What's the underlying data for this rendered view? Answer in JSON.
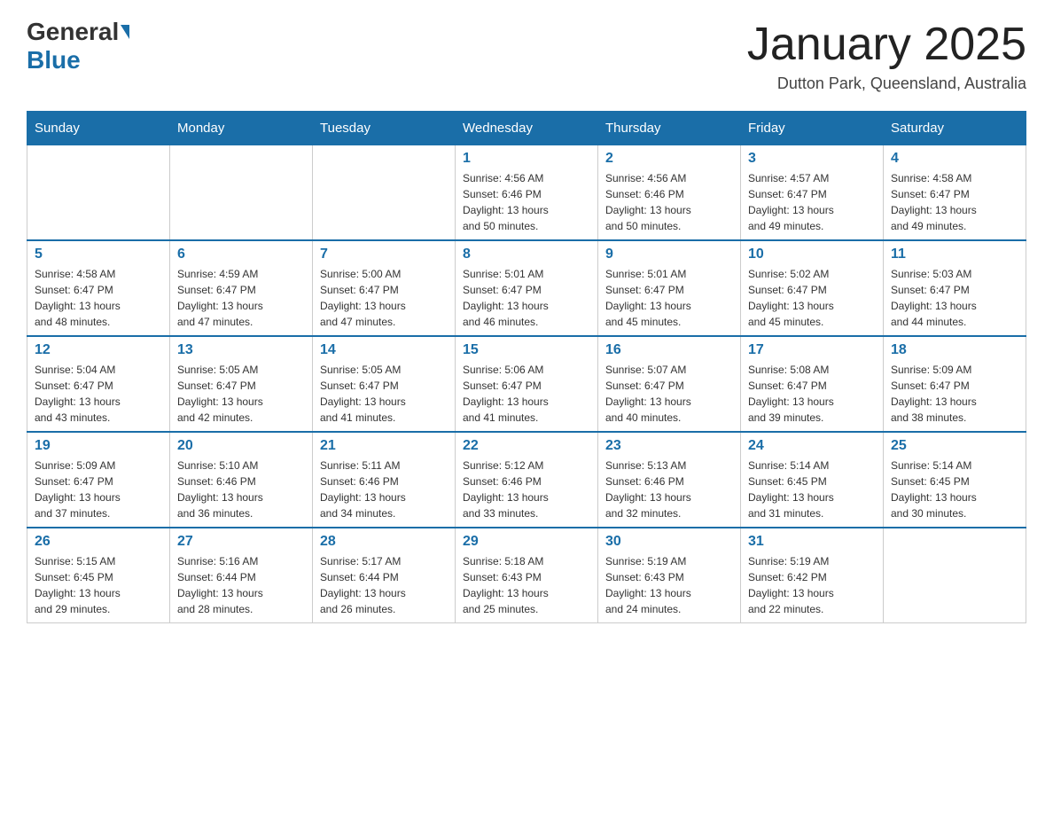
{
  "header": {
    "logo_general": "General",
    "logo_blue": "Blue",
    "month_title": "January 2025",
    "location": "Dutton Park, Queensland, Australia"
  },
  "days_of_week": [
    "Sunday",
    "Monday",
    "Tuesday",
    "Wednesday",
    "Thursday",
    "Friday",
    "Saturday"
  ],
  "weeks": [
    [
      {
        "day": "",
        "info": ""
      },
      {
        "day": "",
        "info": ""
      },
      {
        "day": "",
        "info": ""
      },
      {
        "day": "1",
        "info": "Sunrise: 4:56 AM\nSunset: 6:46 PM\nDaylight: 13 hours\nand 50 minutes."
      },
      {
        "day": "2",
        "info": "Sunrise: 4:56 AM\nSunset: 6:46 PM\nDaylight: 13 hours\nand 50 minutes."
      },
      {
        "day": "3",
        "info": "Sunrise: 4:57 AM\nSunset: 6:47 PM\nDaylight: 13 hours\nand 49 minutes."
      },
      {
        "day": "4",
        "info": "Sunrise: 4:58 AM\nSunset: 6:47 PM\nDaylight: 13 hours\nand 49 minutes."
      }
    ],
    [
      {
        "day": "5",
        "info": "Sunrise: 4:58 AM\nSunset: 6:47 PM\nDaylight: 13 hours\nand 48 minutes."
      },
      {
        "day": "6",
        "info": "Sunrise: 4:59 AM\nSunset: 6:47 PM\nDaylight: 13 hours\nand 47 minutes."
      },
      {
        "day": "7",
        "info": "Sunrise: 5:00 AM\nSunset: 6:47 PM\nDaylight: 13 hours\nand 47 minutes."
      },
      {
        "day": "8",
        "info": "Sunrise: 5:01 AM\nSunset: 6:47 PM\nDaylight: 13 hours\nand 46 minutes."
      },
      {
        "day": "9",
        "info": "Sunrise: 5:01 AM\nSunset: 6:47 PM\nDaylight: 13 hours\nand 45 minutes."
      },
      {
        "day": "10",
        "info": "Sunrise: 5:02 AM\nSunset: 6:47 PM\nDaylight: 13 hours\nand 45 minutes."
      },
      {
        "day": "11",
        "info": "Sunrise: 5:03 AM\nSunset: 6:47 PM\nDaylight: 13 hours\nand 44 minutes."
      }
    ],
    [
      {
        "day": "12",
        "info": "Sunrise: 5:04 AM\nSunset: 6:47 PM\nDaylight: 13 hours\nand 43 minutes."
      },
      {
        "day": "13",
        "info": "Sunrise: 5:05 AM\nSunset: 6:47 PM\nDaylight: 13 hours\nand 42 minutes."
      },
      {
        "day": "14",
        "info": "Sunrise: 5:05 AM\nSunset: 6:47 PM\nDaylight: 13 hours\nand 41 minutes."
      },
      {
        "day": "15",
        "info": "Sunrise: 5:06 AM\nSunset: 6:47 PM\nDaylight: 13 hours\nand 41 minutes."
      },
      {
        "day": "16",
        "info": "Sunrise: 5:07 AM\nSunset: 6:47 PM\nDaylight: 13 hours\nand 40 minutes."
      },
      {
        "day": "17",
        "info": "Sunrise: 5:08 AM\nSunset: 6:47 PM\nDaylight: 13 hours\nand 39 minutes."
      },
      {
        "day": "18",
        "info": "Sunrise: 5:09 AM\nSunset: 6:47 PM\nDaylight: 13 hours\nand 38 minutes."
      }
    ],
    [
      {
        "day": "19",
        "info": "Sunrise: 5:09 AM\nSunset: 6:47 PM\nDaylight: 13 hours\nand 37 minutes."
      },
      {
        "day": "20",
        "info": "Sunrise: 5:10 AM\nSunset: 6:46 PM\nDaylight: 13 hours\nand 36 minutes."
      },
      {
        "day": "21",
        "info": "Sunrise: 5:11 AM\nSunset: 6:46 PM\nDaylight: 13 hours\nand 34 minutes."
      },
      {
        "day": "22",
        "info": "Sunrise: 5:12 AM\nSunset: 6:46 PM\nDaylight: 13 hours\nand 33 minutes."
      },
      {
        "day": "23",
        "info": "Sunrise: 5:13 AM\nSunset: 6:46 PM\nDaylight: 13 hours\nand 32 minutes."
      },
      {
        "day": "24",
        "info": "Sunrise: 5:14 AM\nSunset: 6:45 PM\nDaylight: 13 hours\nand 31 minutes."
      },
      {
        "day": "25",
        "info": "Sunrise: 5:14 AM\nSunset: 6:45 PM\nDaylight: 13 hours\nand 30 minutes."
      }
    ],
    [
      {
        "day": "26",
        "info": "Sunrise: 5:15 AM\nSunset: 6:45 PM\nDaylight: 13 hours\nand 29 minutes."
      },
      {
        "day": "27",
        "info": "Sunrise: 5:16 AM\nSunset: 6:44 PM\nDaylight: 13 hours\nand 28 minutes."
      },
      {
        "day": "28",
        "info": "Sunrise: 5:17 AM\nSunset: 6:44 PM\nDaylight: 13 hours\nand 26 minutes."
      },
      {
        "day": "29",
        "info": "Sunrise: 5:18 AM\nSunset: 6:43 PM\nDaylight: 13 hours\nand 25 minutes."
      },
      {
        "day": "30",
        "info": "Sunrise: 5:19 AM\nSunset: 6:43 PM\nDaylight: 13 hours\nand 24 minutes."
      },
      {
        "day": "31",
        "info": "Sunrise: 5:19 AM\nSunset: 6:42 PM\nDaylight: 13 hours\nand 22 minutes."
      },
      {
        "day": "",
        "info": ""
      }
    ]
  ]
}
